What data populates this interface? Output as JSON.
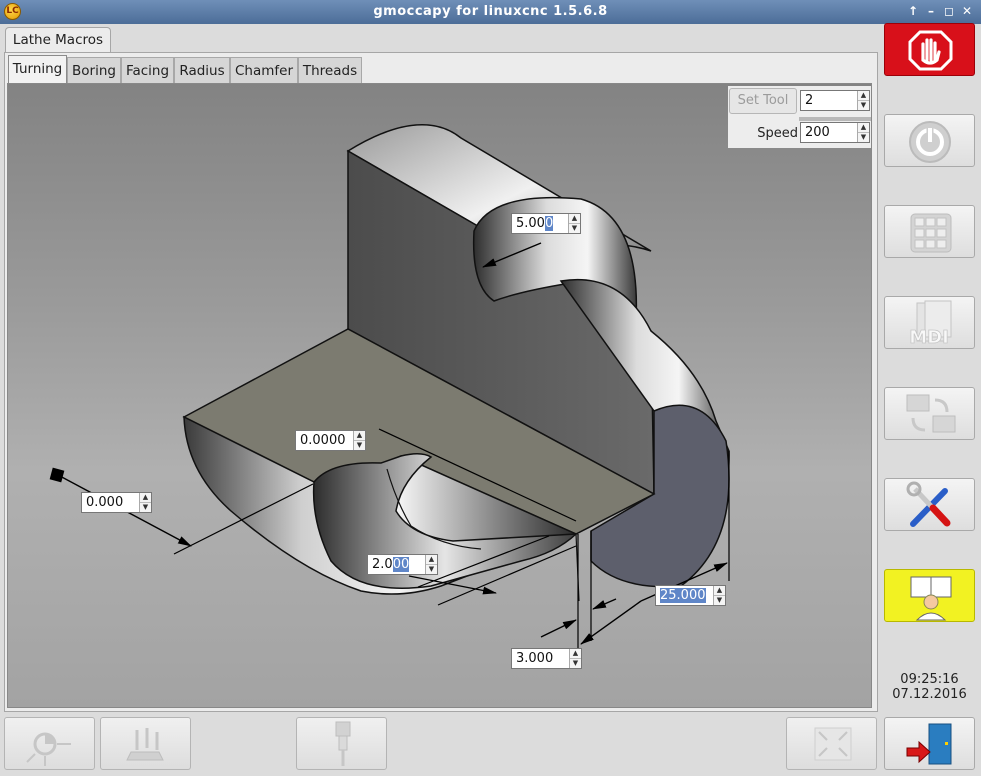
{
  "window": {
    "title": "gmoccapy for linuxcnc  1.5.6.8",
    "icons": [
      "app-icon",
      "keep-above-icon",
      "minimize-icon",
      "maximize-icon",
      "close-icon"
    ]
  },
  "outer_tab": {
    "label": "Lathe Macros"
  },
  "inner_tabs": [
    {
      "label": "Turning",
      "active": true
    },
    {
      "label": "Boring",
      "active": false
    },
    {
      "label": "Facing",
      "active": false
    },
    {
      "label": "Radius",
      "active": false
    },
    {
      "label": "Chamfer",
      "active": false
    },
    {
      "label": "Threads",
      "active": false
    }
  ],
  "tool": {
    "set_tool_label": "Set Tool",
    "tool_value": "2",
    "speed_label": "Speed",
    "speed_value": "200"
  },
  "fields": {
    "radius": {
      "value_pre": "5.00",
      "value_sel": "0",
      "value_post": ""
    },
    "x_start": {
      "value": "0.0000"
    },
    "z_start": {
      "value": "0.000"
    },
    "depth": {
      "value_pre": "2.0",
      "value_sel": "00",
      "value_post": ""
    },
    "diameter": {
      "value_pre": "",
      "value_sel": "25.000",
      "value_post": ""
    },
    "length": {
      "value": "3.000"
    }
  },
  "sidebar": {
    "buttons": [
      {
        "name": "estop-button",
        "icon": "hand-stop-icon",
        "enabled": true
      },
      {
        "name": "machine-on-button",
        "icon": "power-icon",
        "enabled": false
      },
      {
        "name": "manual-mode-button",
        "icon": "jog-keypad-icon",
        "enabled": false
      },
      {
        "name": "mdi-button",
        "icon": "mdi-icon",
        "label": "MDI",
        "enabled": false
      },
      {
        "name": "auto-mode-button",
        "icon": "auto-icon",
        "enabled": false
      },
      {
        "name": "settings-button",
        "icon": "tools-icon",
        "enabled": true
      },
      {
        "name": "user-tabs-button",
        "icon": "user-tabs-icon",
        "enabled": true
      }
    ],
    "time": "09:25:16",
    "date": "07.12.2016",
    "exit_icon": "exit-door-icon"
  },
  "bottom_bar": {
    "buttons": [
      {
        "name": "touch-off-button",
        "icon": "touch-off-icon",
        "enabled": false
      },
      {
        "name": "tool-measure-button",
        "icon": "tool-measure-icon",
        "enabled": false
      },
      {
        "name": "spindle-button",
        "icon": "spindle-icon",
        "enabled": false
      },
      {
        "name": "fullscreen-button",
        "icon": "fullscreen-icon",
        "enabled": false
      }
    ]
  },
  "colors": {
    "estop_red": "#d8101a",
    "user_tab_yellow": "#f2f222",
    "selection_blue": "#5f86c8"
  }
}
